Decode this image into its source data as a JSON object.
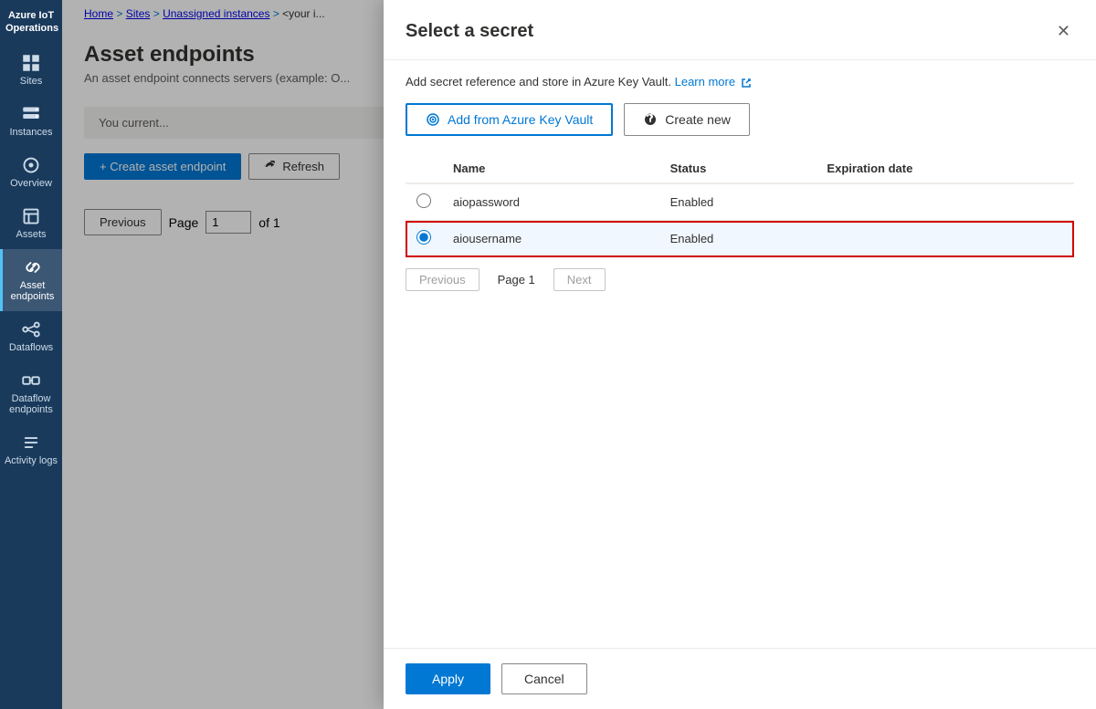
{
  "app": {
    "title": "Azure IoT Operations"
  },
  "sidebar": {
    "items": [
      {
        "id": "sites",
        "label": "Sites",
        "icon": "grid"
      },
      {
        "id": "instances",
        "label": "Instances",
        "icon": "server",
        "active": false
      },
      {
        "id": "overview",
        "label": "Overview",
        "icon": "eye"
      },
      {
        "id": "assets",
        "label": "Assets",
        "icon": "box"
      },
      {
        "id": "asset-endpoints",
        "label": "Asset endpoints",
        "icon": "link",
        "active": true
      },
      {
        "id": "dataflows",
        "label": "Dataflows",
        "icon": "flow"
      },
      {
        "id": "dataflow-endpoints",
        "label": "Dataflow endpoints",
        "icon": "flow-link"
      },
      {
        "id": "activity-logs",
        "label": "Activity logs",
        "icon": "list"
      }
    ]
  },
  "breadcrumb": {
    "parts": [
      "Home",
      "Sites",
      "Unassigned instances",
      "<your i..."
    ]
  },
  "page": {
    "title": "Asset endpoints",
    "description": "An asset endpoint connects servers (example: O..."
  },
  "content": {
    "banner_text": "You current...",
    "create_button": "+ Create asset endpoint",
    "refresh_button": "Refresh",
    "pagination": {
      "previous_label": "Previous",
      "page_label": "Page",
      "page_value": "1",
      "of_label": "of 1"
    }
  },
  "modal": {
    "title": "Select a secret",
    "description": "Add secret reference and store in Azure Key Vault.",
    "learn_more_label": "Learn more",
    "add_button_label": "Add from Azure Key Vault",
    "create_button_label": "Create new",
    "table": {
      "columns": [
        "Name",
        "Status",
        "Expiration date"
      ],
      "rows": [
        {
          "name": "aiopassword",
          "status": "Enabled",
          "expiration": "",
          "selected": false
        },
        {
          "name": "aiousername",
          "status": "Enabled",
          "expiration": "",
          "selected": true
        }
      ]
    },
    "pagination": {
      "previous_label": "Previous",
      "page_label": "Page 1",
      "next_label": "Next"
    },
    "apply_label": "Apply",
    "cancel_label": "Cancel"
  }
}
